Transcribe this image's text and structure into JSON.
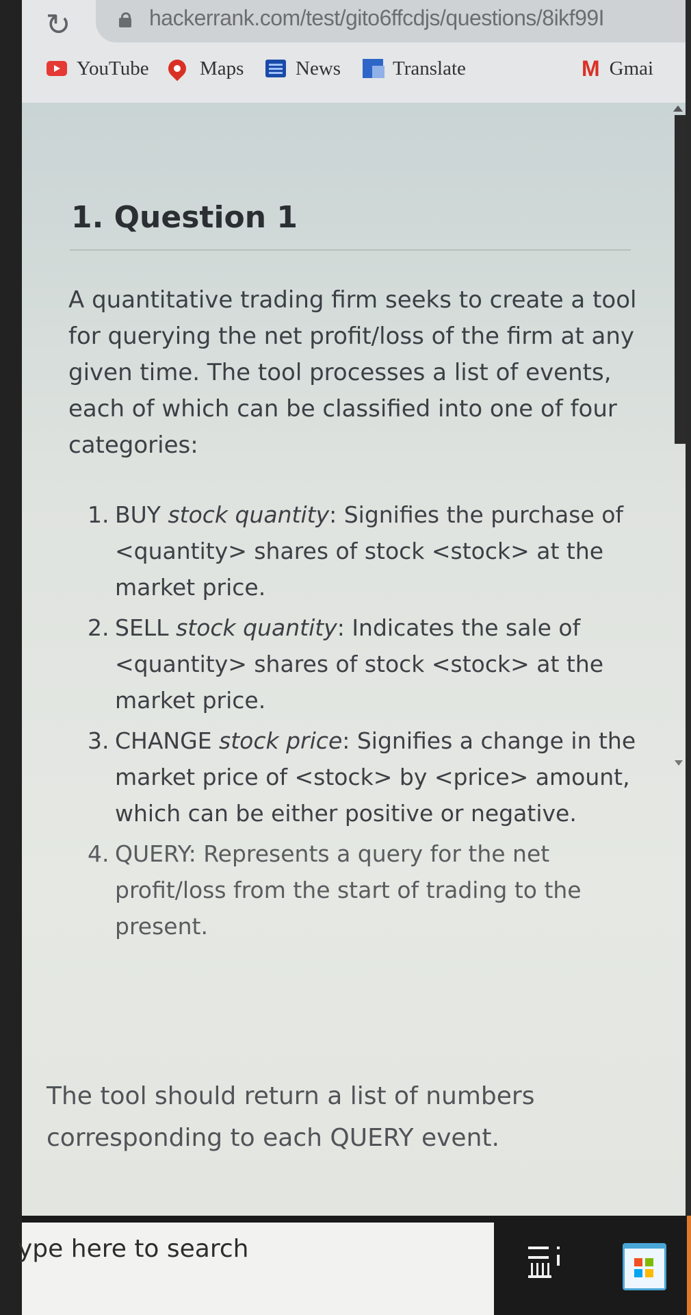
{
  "browser": {
    "url": "hackerrank.com/test/gito6ffcdjs/questions/8ikf99I",
    "bookmarks": [
      {
        "label": "YouTube",
        "icon": "youtube-icon"
      },
      {
        "label": "Maps",
        "icon": "maps-icon"
      },
      {
        "label": "News",
        "icon": "news-icon"
      },
      {
        "label": "Translate",
        "icon": "translate-icon"
      },
      {
        "label": "Gmai",
        "icon": "gmail-icon"
      }
    ]
  },
  "question": {
    "title": "1. Question 1",
    "intro": "A quantitative trading firm seeks to create a tool for querying the net profit/loss of the firm at any given time. The tool processes a list of events, each of which can be classified into one of four categories:",
    "items": [
      {
        "num": "1.",
        "cmd": "BUY",
        "args": "stock quantity",
        "desc": ": Signifies the purchase of <quantity> shares of stock <stock> at the market price."
      },
      {
        "num": "2.",
        "cmd": "SELL",
        "args": "stock quantity",
        "desc": ": Indicates the sale of <quantity> shares of stock <stock> at the market price."
      },
      {
        "num": "3.",
        "cmd": "CHANGE",
        "args": "stock price",
        "desc": ": Signifies a change in the market price of <stock> by <price> amount, which can be either positive or negative."
      },
      {
        "num": "4.",
        "cmd": "QUERY:",
        "args": "",
        "desc": "Represents a query for the net profit/loss from the start of trading to the present."
      }
    ],
    "closing": "The tool should return a list of numbers corresponding to each QUERY event."
  },
  "taskbar": {
    "search_text": "ype here to search"
  },
  "colors": {
    "page_bg": "#dfe3df",
    "text": "#3c3f44",
    "youtube": "#e53935",
    "maps": "#d93025",
    "taskbar": "#1a1a1a"
  }
}
